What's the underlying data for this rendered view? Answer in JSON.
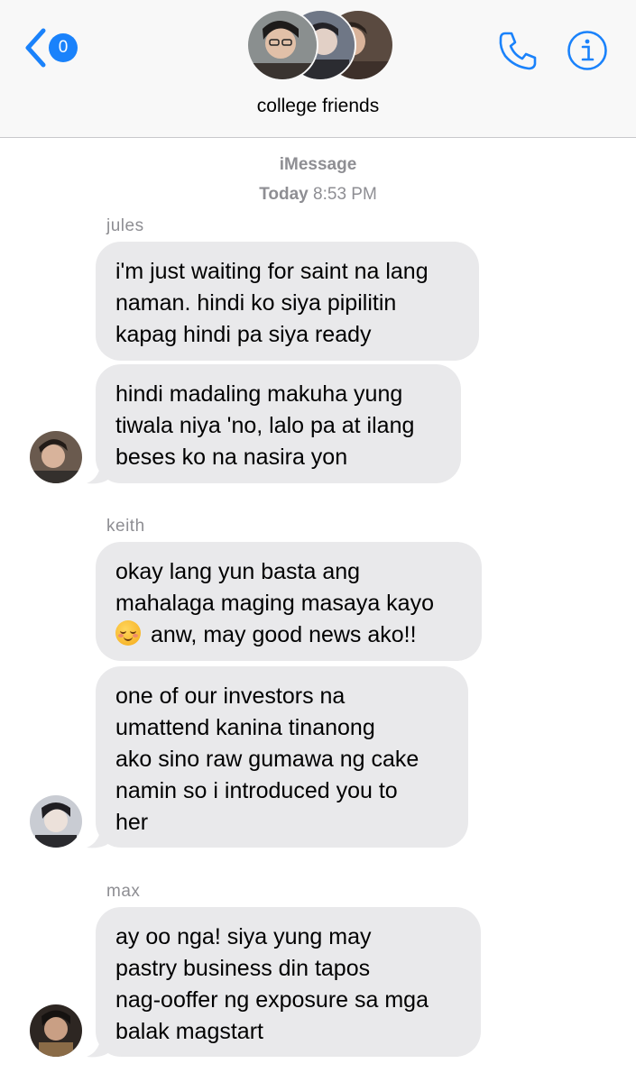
{
  "header": {
    "back_badge": "0",
    "group_name": "college friends",
    "colors": {
      "accent": "#1a82fb",
      "header_bg": "#f8f8f8",
      "bubble_incoming": "#e9e9eb",
      "meta_text": "#8e8e93"
    },
    "icons": [
      "chevron-left-icon",
      "phone-icon",
      "info-icon"
    ]
  },
  "thread": {
    "service": "iMessage",
    "timestamp_day": "Today",
    "timestamp_time": "8:53 PM"
  },
  "messages": [
    {
      "sender": "jules",
      "bubbles": [
        {
          "lines": [
            "i'm just waiting for saint na lang",
            "naman. hindi ko siya pipilitin",
            "kapag hindi pa siya ready"
          ]
        },
        {
          "lines": [
            "hindi madaling makuha yung",
            "tiwala niya 'no, lalo pa at ilang",
            "beses ko na nasira yon"
          ]
        }
      ]
    },
    {
      "sender": "keith",
      "bubbles": [
        {
          "lines": [
            "okay lang yun basta ang",
            "mahalaga maging masaya kayo",
            "anw, may good news ako!!"
          ],
          "emoji": "smiling-face-with-blush-icon"
        },
        {
          "lines": [
            "one of our investors na",
            "umattend kanina tinanong",
            "ako sino raw gumawa ng cake",
            "namin so i introduced you to",
            "her"
          ]
        }
      ]
    },
    {
      "sender": "max",
      "bubbles": [
        {
          "lines": [
            "ay oo nga! siya yung may",
            "pastry business din tapos",
            "nag-ooffer ng exposure sa mga",
            "balak magstart"
          ]
        }
      ]
    }
  ]
}
